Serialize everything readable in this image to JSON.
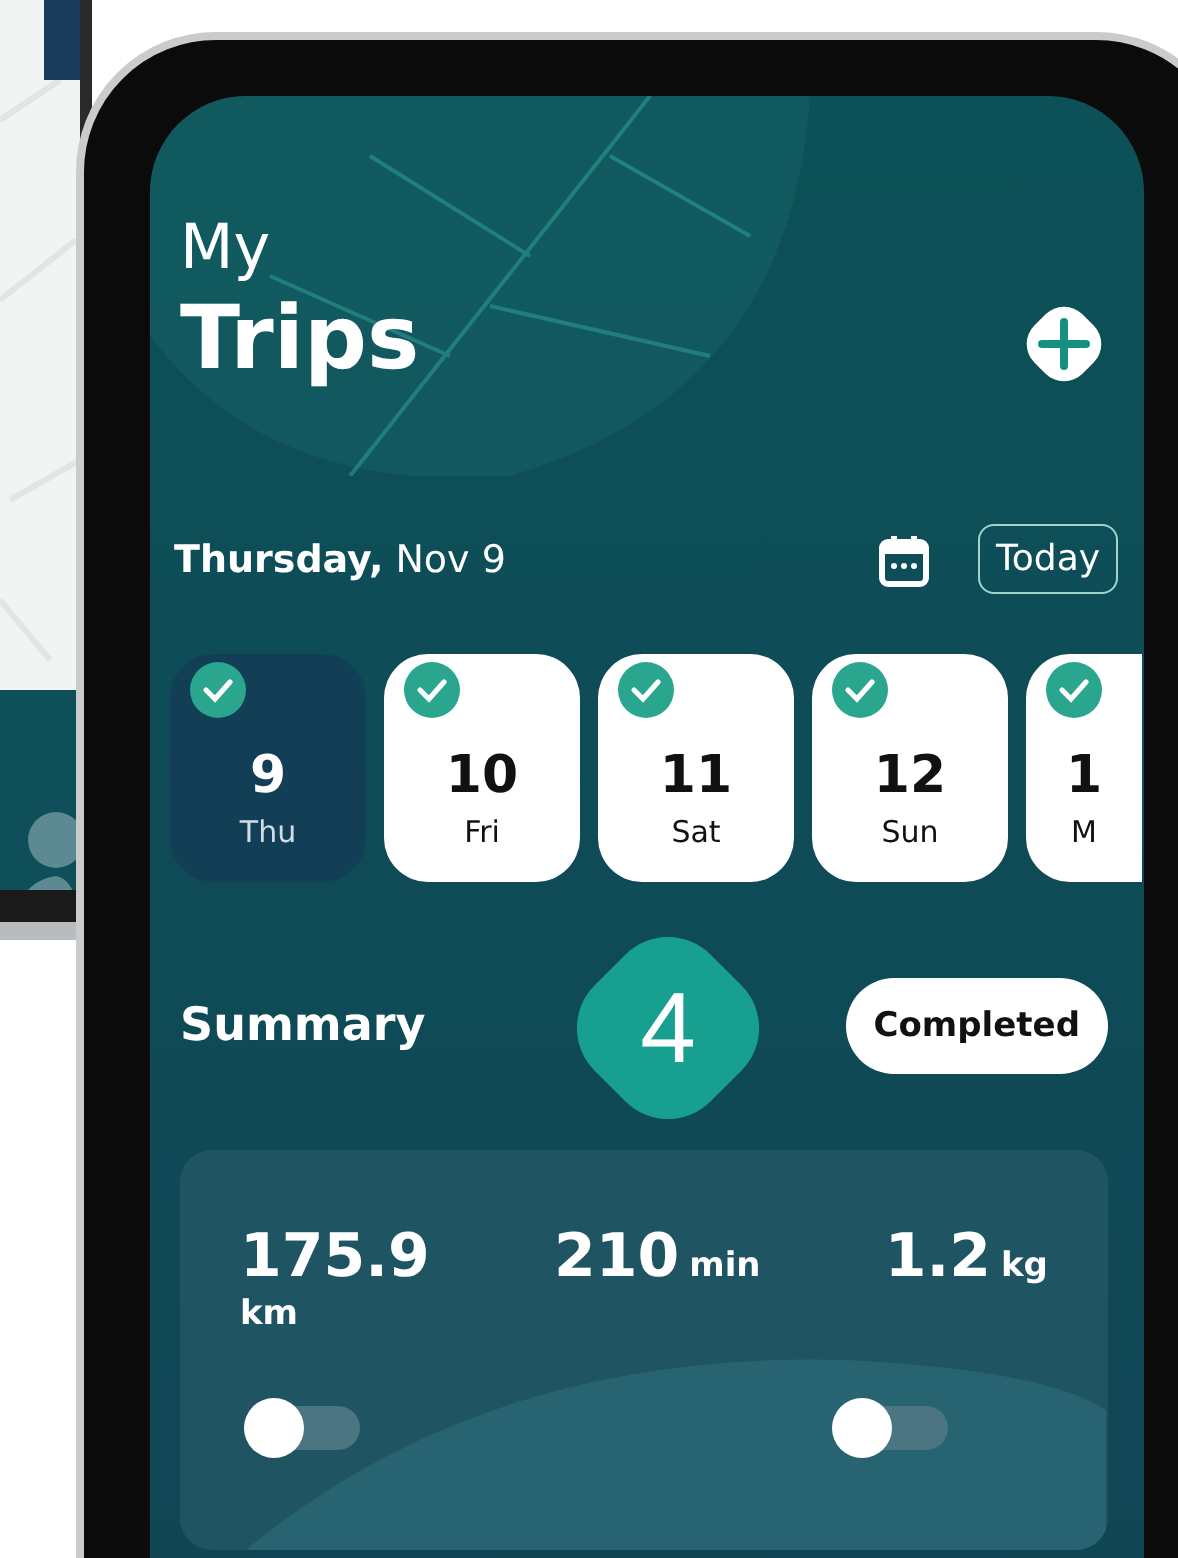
{
  "title": {
    "line1": "My",
    "line2": "Trips"
  },
  "date": "**Thursday,** Nov 9",
  "today_button": "Today",
  "days": [
    {
      "number": "9",
      "weekday": "Thu",
      "selected": true,
      "checked": true
    },
    {
      "number": "10",
      "weekday": "Fri",
      "selected": false,
      "checked": true
    },
    {
      "number": "11",
      "weekday": "Sat",
      "selected": false,
      "checked": true
    },
    {
      "number": "12",
      "weekday": "Sun",
      "selected": false,
      "checked": true
    },
    {
      "number": "1",
      "weekday": "M",
      "selected": false,
      "checked": true
    }
  ],
  "summary": {
    "title": "Summary",
    "filter": "Completed"
  },
  "step_badge": "4",
  "stats": [
    {
      "value": "175.9",
      "unit": "km",
      "kind": "stacked"
    },
    {
      "value": "210",
      "unit": "min",
      "kind": "inline"
    },
    {
      "value": "1.2",
      "unit": "kg",
      "kind": "inline"
    }
  ],
  "toggles": [
    {
      "on": false
    },
    {
      "on": false
    }
  ]
}
